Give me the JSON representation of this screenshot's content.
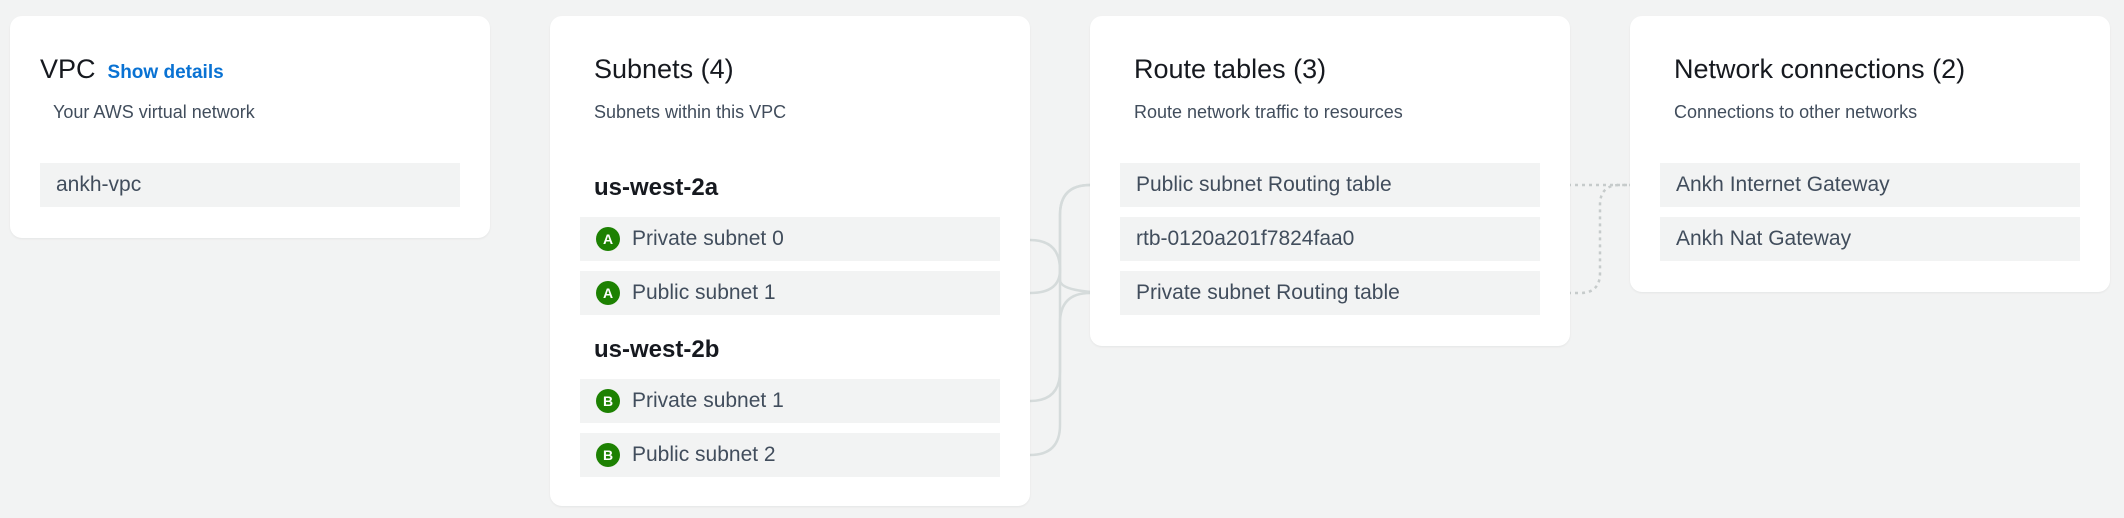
{
  "vpc": {
    "title": "VPC",
    "show_details": "Show details",
    "description": "Your AWS virtual network",
    "name": "ankh-vpc"
  },
  "subnets": {
    "title": "Subnets (4)",
    "description": "Subnets within this VPC",
    "zones": [
      {
        "label": "us-west-2a",
        "items": [
          {
            "badge": "A",
            "label": "Private subnet 0"
          },
          {
            "badge": "A",
            "label": "Public subnet 1"
          }
        ]
      },
      {
        "label": "us-west-2b",
        "items": [
          {
            "badge": "B",
            "label": "Private subnet 1"
          },
          {
            "badge": "B",
            "label": "Public subnet 2"
          }
        ]
      }
    ]
  },
  "route_tables": {
    "title": "Route tables (3)",
    "description": "Route network traffic to resources",
    "items": [
      {
        "label": "Public subnet Routing table"
      },
      {
        "label": "rtb-0120a201f7824faa0"
      },
      {
        "label": "Private subnet Routing table"
      }
    ]
  },
  "network_connections": {
    "title": "Network connections (2)",
    "description": "Connections to other networks",
    "items": [
      {
        "label": "Ankh Internet Gateway"
      },
      {
        "label": "Ankh Nat Gateway"
      }
    ]
  },
  "colors": {
    "badge_green": "#1d8102",
    "link_blue": "#0972d3",
    "item_bg": "#f2f3f3",
    "connector": "#d1d5db"
  }
}
